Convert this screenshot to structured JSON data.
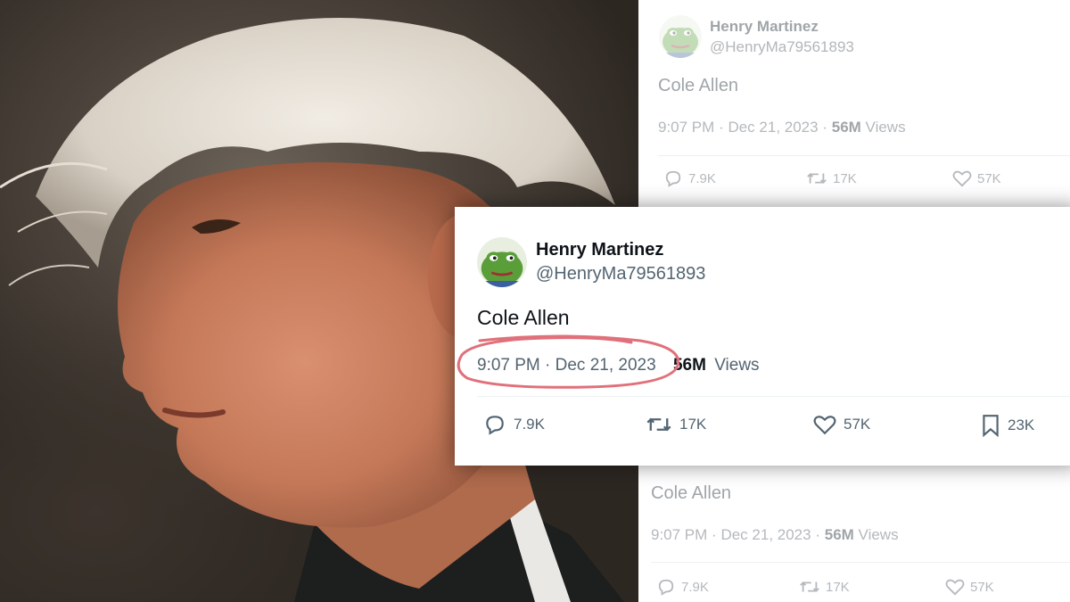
{
  "colors": {
    "accent_annotation": "#e0707a",
    "text_primary": "#0f1419",
    "text_secondary": "#536471",
    "avatar_green": "#5a9e3a"
  },
  "photo": {
    "description_icon": "portrait-photo"
  },
  "tweet_top": {
    "display_name": "Henry Martinez",
    "handle": "@HenryMa79561893",
    "text": "Cole Allen",
    "time": "9:07 PM",
    "separator": "·",
    "date": "Dec 21, 2023",
    "separator2": "·",
    "views_count": "56M",
    "views_label": "Views",
    "replies": "7.9K",
    "reposts": "17K",
    "likes": "57K"
  },
  "tweet_main": {
    "display_name": "Henry Martinez",
    "handle": "@HenryMa79561893",
    "text": "Cole Allen",
    "timestamp": "9:07 PM · Dec 21, 2023",
    "views_count": "56M",
    "views_label": "Views",
    "replies": "7.9K",
    "reposts": "17K",
    "likes": "57K",
    "bookmarks": "23K"
  },
  "tweet_bottom": {
    "text": "Cole Allen",
    "time": "9:07 PM",
    "separator": "·",
    "date": "Dec 21, 2023",
    "separator2": "·",
    "views_count": "56M",
    "views_label": "Views",
    "replies": "7.9K",
    "reposts": "17K",
    "likes": "57K"
  }
}
